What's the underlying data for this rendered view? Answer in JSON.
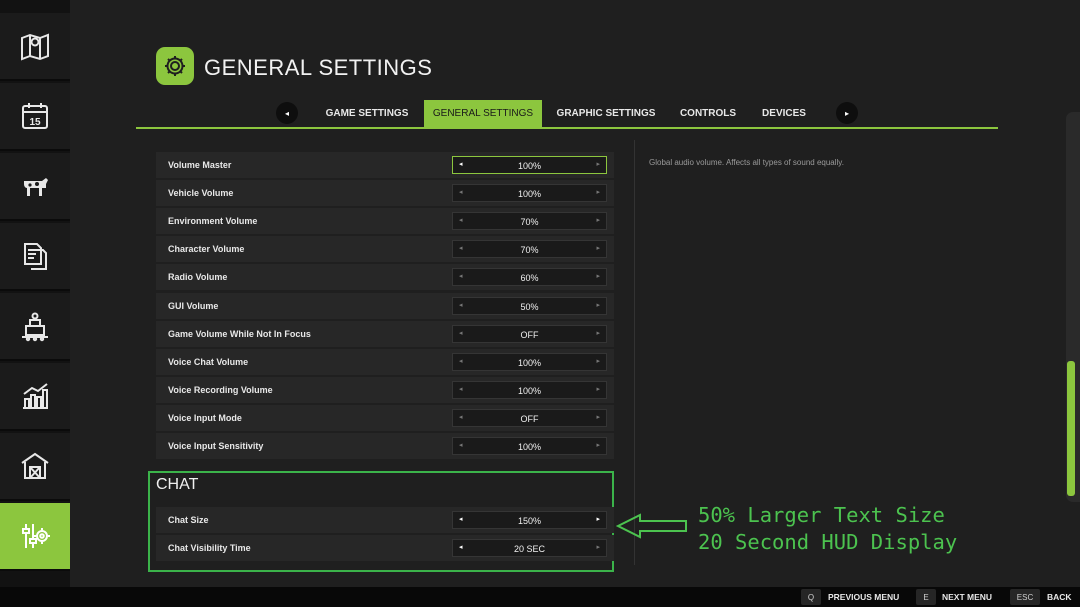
{
  "colors": {
    "accent": "#8cc63e",
    "annotation": "#4cc34f",
    "panel": "#1f1f1f",
    "row": "#272727"
  },
  "sidebar": {
    "items": [
      {
        "icon": "map-icon"
      },
      {
        "icon": "calendar-icon",
        "day": "15"
      },
      {
        "icon": "cow-icon"
      },
      {
        "icon": "documents-icon"
      },
      {
        "icon": "factory-icon"
      },
      {
        "icon": "statistics-icon"
      },
      {
        "icon": "barn-icon"
      },
      {
        "icon": "settings-icon",
        "active": true
      }
    ]
  },
  "header": {
    "title": "GENERAL SETTINGS",
    "icon": "gear-icon"
  },
  "tabs": {
    "prev_arrow": "◂",
    "next_arrow": "▸",
    "items": [
      {
        "label": "GAME SETTINGS"
      },
      {
        "label": "GENERAL SETTINGS",
        "active": true
      },
      {
        "label": "GRAPHIC SETTINGS"
      },
      {
        "label": "CONTROLS"
      },
      {
        "label": "DEVICES"
      }
    ]
  },
  "arrows": {
    "left": "◂",
    "right": "▸"
  },
  "settings": [
    {
      "label": "Volume Master",
      "value": "100%",
      "left_on": true,
      "right_on": false,
      "focused": true
    },
    {
      "label": "Vehicle Volume",
      "value": "100%",
      "left_on": false,
      "right_on": false
    },
    {
      "label": "Environment Volume",
      "value": "70%",
      "left_on": false,
      "right_on": false
    },
    {
      "label": "Character Volume",
      "value": "70%",
      "left_on": false,
      "right_on": false
    },
    {
      "label": "Radio Volume",
      "value": "60%",
      "left_on": false,
      "right_on": false
    },
    {
      "label": "GUI Volume",
      "value": "50%",
      "left_on": false,
      "right_on": false
    },
    {
      "label": "Game Volume While Not In Focus",
      "value": "OFF",
      "left_on": false,
      "right_on": false
    },
    {
      "label": "Voice Chat Volume",
      "value": "100%",
      "left_on": false,
      "right_on": false
    },
    {
      "label": "Voice Recording Volume",
      "value": "100%",
      "left_on": false,
      "right_on": false
    },
    {
      "label": "Voice Input Mode",
      "value": "OFF",
      "left_on": false,
      "right_on": false
    },
    {
      "label": "Voice Input Sensitivity",
      "value": "100%",
      "left_on": false,
      "right_on": false
    }
  ],
  "chat": {
    "title": "CHAT",
    "settings": [
      {
        "label": "Chat Size",
        "value": "150%",
        "left_on": true,
        "right_on": true
      },
      {
        "label": "Chat Visibility Time",
        "value": "20 SEC",
        "left_on": true,
        "right_on": false
      }
    ]
  },
  "description": "Global audio volume. Affects all types of sound equally.",
  "annotation": {
    "line1": "50% Larger Text Size",
    "line2": "20 Second HUD Display"
  },
  "footer": {
    "buttons": [
      {
        "key": "Q",
        "label": "PREVIOUS MENU"
      },
      {
        "key": "E",
        "label": "NEXT MENU"
      },
      {
        "key": "ESC",
        "label": "BACK"
      }
    ]
  }
}
